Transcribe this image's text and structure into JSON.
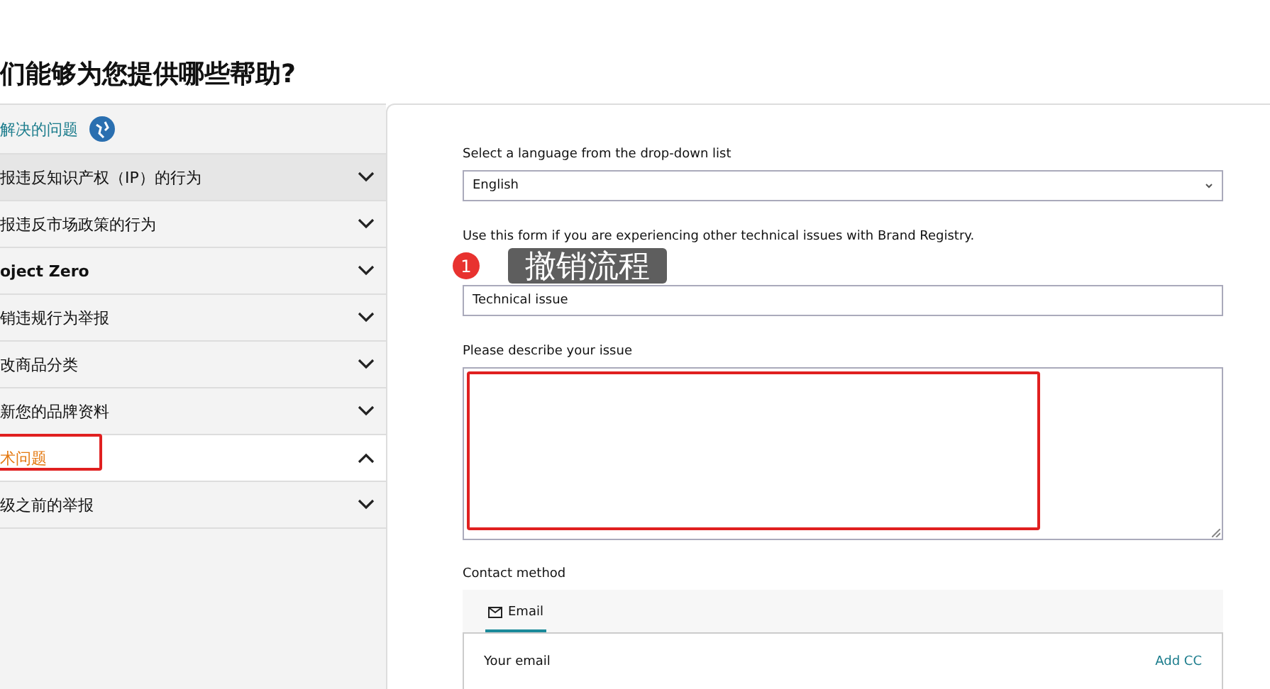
{
  "heading": "们能够为您提供哪些帮助?",
  "sidebar": {
    "header": "解决的问题",
    "items": [
      {
        "label": "报违反知识产权（IP）的行为",
        "selected": false,
        "expanded": false,
        "hovered": true
      },
      {
        "label": "报违反市场政策的行为",
        "selected": false,
        "expanded": false,
        "hovered": false
      },
      {
        "label": "oject Zero",
        "selected": false,
        "expanded": false,
        "hovered": false
      },
      {
        "label": "销违规行为举报",
        "selected": false,
        "expanded": false,
        "hovered": false
      },
      {
        "label": "改商品分类",
        "selected": false,
        "expanded": false,
        "hovered": false
      },
      {
        "label": "新您的品牌资料",
        "selected": false,
        "expanded": false,
        "hovered": false
      },
      {
        "label": "术问题",
        "selected": true,
        "expanded": true,
        "hovered": false
      },
      {
        "label": "级之前的举报",
        "selected": false,
        "expanded": false,
        "hovered": false
      }
    ]
  },
  "form": {
    "language_label": "Select a language from the drop-down list",
    "language_value": "English",
    "intro": "Use this form if you are experiencing other technical issues with Brand Registry.",
    "short_description_value": "Technical issue",
    "describe_label": "Please describe your issue",
    "contact_label": "Contact method",
    "contact_tabs": [
      {
        "label": "Email",
        "selected": true
      }
    ],
    "email_label": "Your email",
    "add_cc": "Add CC"
  },
  "annotation": {
    "badge": "1",
    "text": "撤销流程"
  }
}
